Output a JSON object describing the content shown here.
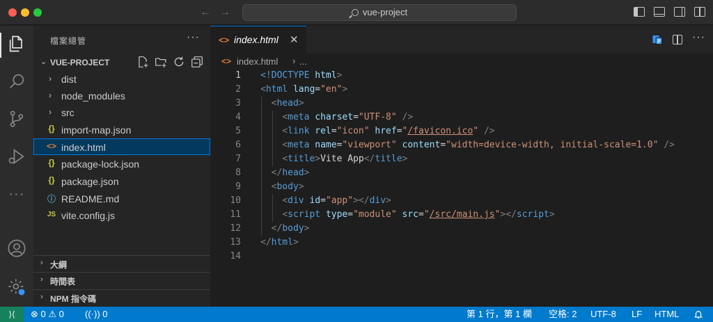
{
  "titlebar": {
    "search_text": "vue-project",
    "nav_back": "←",
    "nav_forward": "→"
  },
  "activity": {
    "more": "···"
  },
  "sidebar": {
    "header": "檔案總管",
    "header_more": "···",
    "project_name": "VUE-PROJECT",
    "items": [
      {
        "type": "folder",
        "icon": "chevron-right-icon",
        "glyph": "›",
        "label": "dist"
      },
      {
        "type": "folder",
        "icon": "chevron-right-icon",
        "glyph": "›",
        "label": "node_modules"
      },
      {
        "type": "folder",
        "icon": "chevron-right-icon",
        "glyph": "›",
        "label": "src"
      },
      {
        "type": "file",
        "icon": "json-file-icon",
        "glyph": "{}",
        "label": "import-map.json"
      },
      {
        "type": "file",
        "icon": "html-file-icon",
        "glyph": "<>",
        "label": "index.html",
        "selected": true
      },
      {
        "type": "file",
        "icon": "json-file-icon",
        "glyph": "{}",
        "label": "package-lock.json"
      },
      {
        "type": "file",
        "icon": "json-file-icon",
        "glyph": "{}",
        "label": "package.json"
      },
      {
        "type": "file",
        "icon": "info-file-icon",
        "glyph": "ⓘ",
        "label": "README.md"
      },
      {
        "type": "file",
        "icon": "js-file-icon",
        "glyph": "JS",
        "label": "vite.config.js"
      }
    ],
    "sections": {
      "outline": "大綱",
      "timeline": "時間表",
      "npm": "NPM 指令碼"
    }
  },
  "editor": {
    "tab": {
      "icon_glyph": "<>",
      "label": "index.html",
      "close": "✕"
    },
    "more": "···",
    "breadcrumb": {
      "icon_glyph": "<>",
      "file": "index.html",
      "sep": "›",
      "rest": "..."
    },
    "line_numbers": [
      "1",
      "2",
      "3",
      "4",
      "5",
      "6",
      "7",
      "8",
      "9",
      "10",
      "11",
      "12",
      "13",
      "14"
    ],
    "code": {
      "l1_doctype": "<!DOCTYPE",
      "l1_html": "html",
      "l2_html": "html",
      "l2_attr": "lang",
      "l2_val": "\"en\"",
      "l3_head": "head",
      "l4_meta": "meta",
      "l4_attr": "charset",
      "l4_val": "\"UTF-8\"",
      "l5_link": "link",
      "l5_attr1": "rel",
      "l5_val1": "\"icon\"",
      "l5_attr2": "href",
      "l5_val2_q": "\"",
      "l5_val2_path": "/favicon.ico",
      "l6_meta": "meta",
      "l6_attr1": "name",
      "l6_val1": "\"viewport\"",
      "l6_attr2": "content",
      "l6_val2": "\"width=device-width, initial-scale=1.0\"",
      "l7_title": "title",
      "l7_text": "Vite App",
      "l8_head": "head",
      "l9_body": "body",
      "l10_div": "div",
      "l10_attr": "id",
      "l10_val": "\"app\"",
      "l11_script": "script",
      "l11_attr1": "type",
      "l11_val1": "\"module\"",
      "l11_attr2": "src",
      "l11_val2_path": "/src/main.js",
      "l12_body": "body",
      "l13_html": "html"
    }
  },
  "statusbar": {
    "remote": "⟩⟨",
    "problems": "⊗ 0 ⚠ 0",
    "ports": "((·)) 0",
    "position": "第 1 行，第 1 欄",
    "spaces": "空格: 2",
    "encoding": "UTF-8",
    "eol": "LF",
    "language": "HTML"
  },
  "colors": {
    "accent": "#007acc",
    "remote": "#16825d",
    "html_icon": "#e37933",
    "json_icon": "#cbcb41",
    "info_icon": "#519aba"
  }
}
